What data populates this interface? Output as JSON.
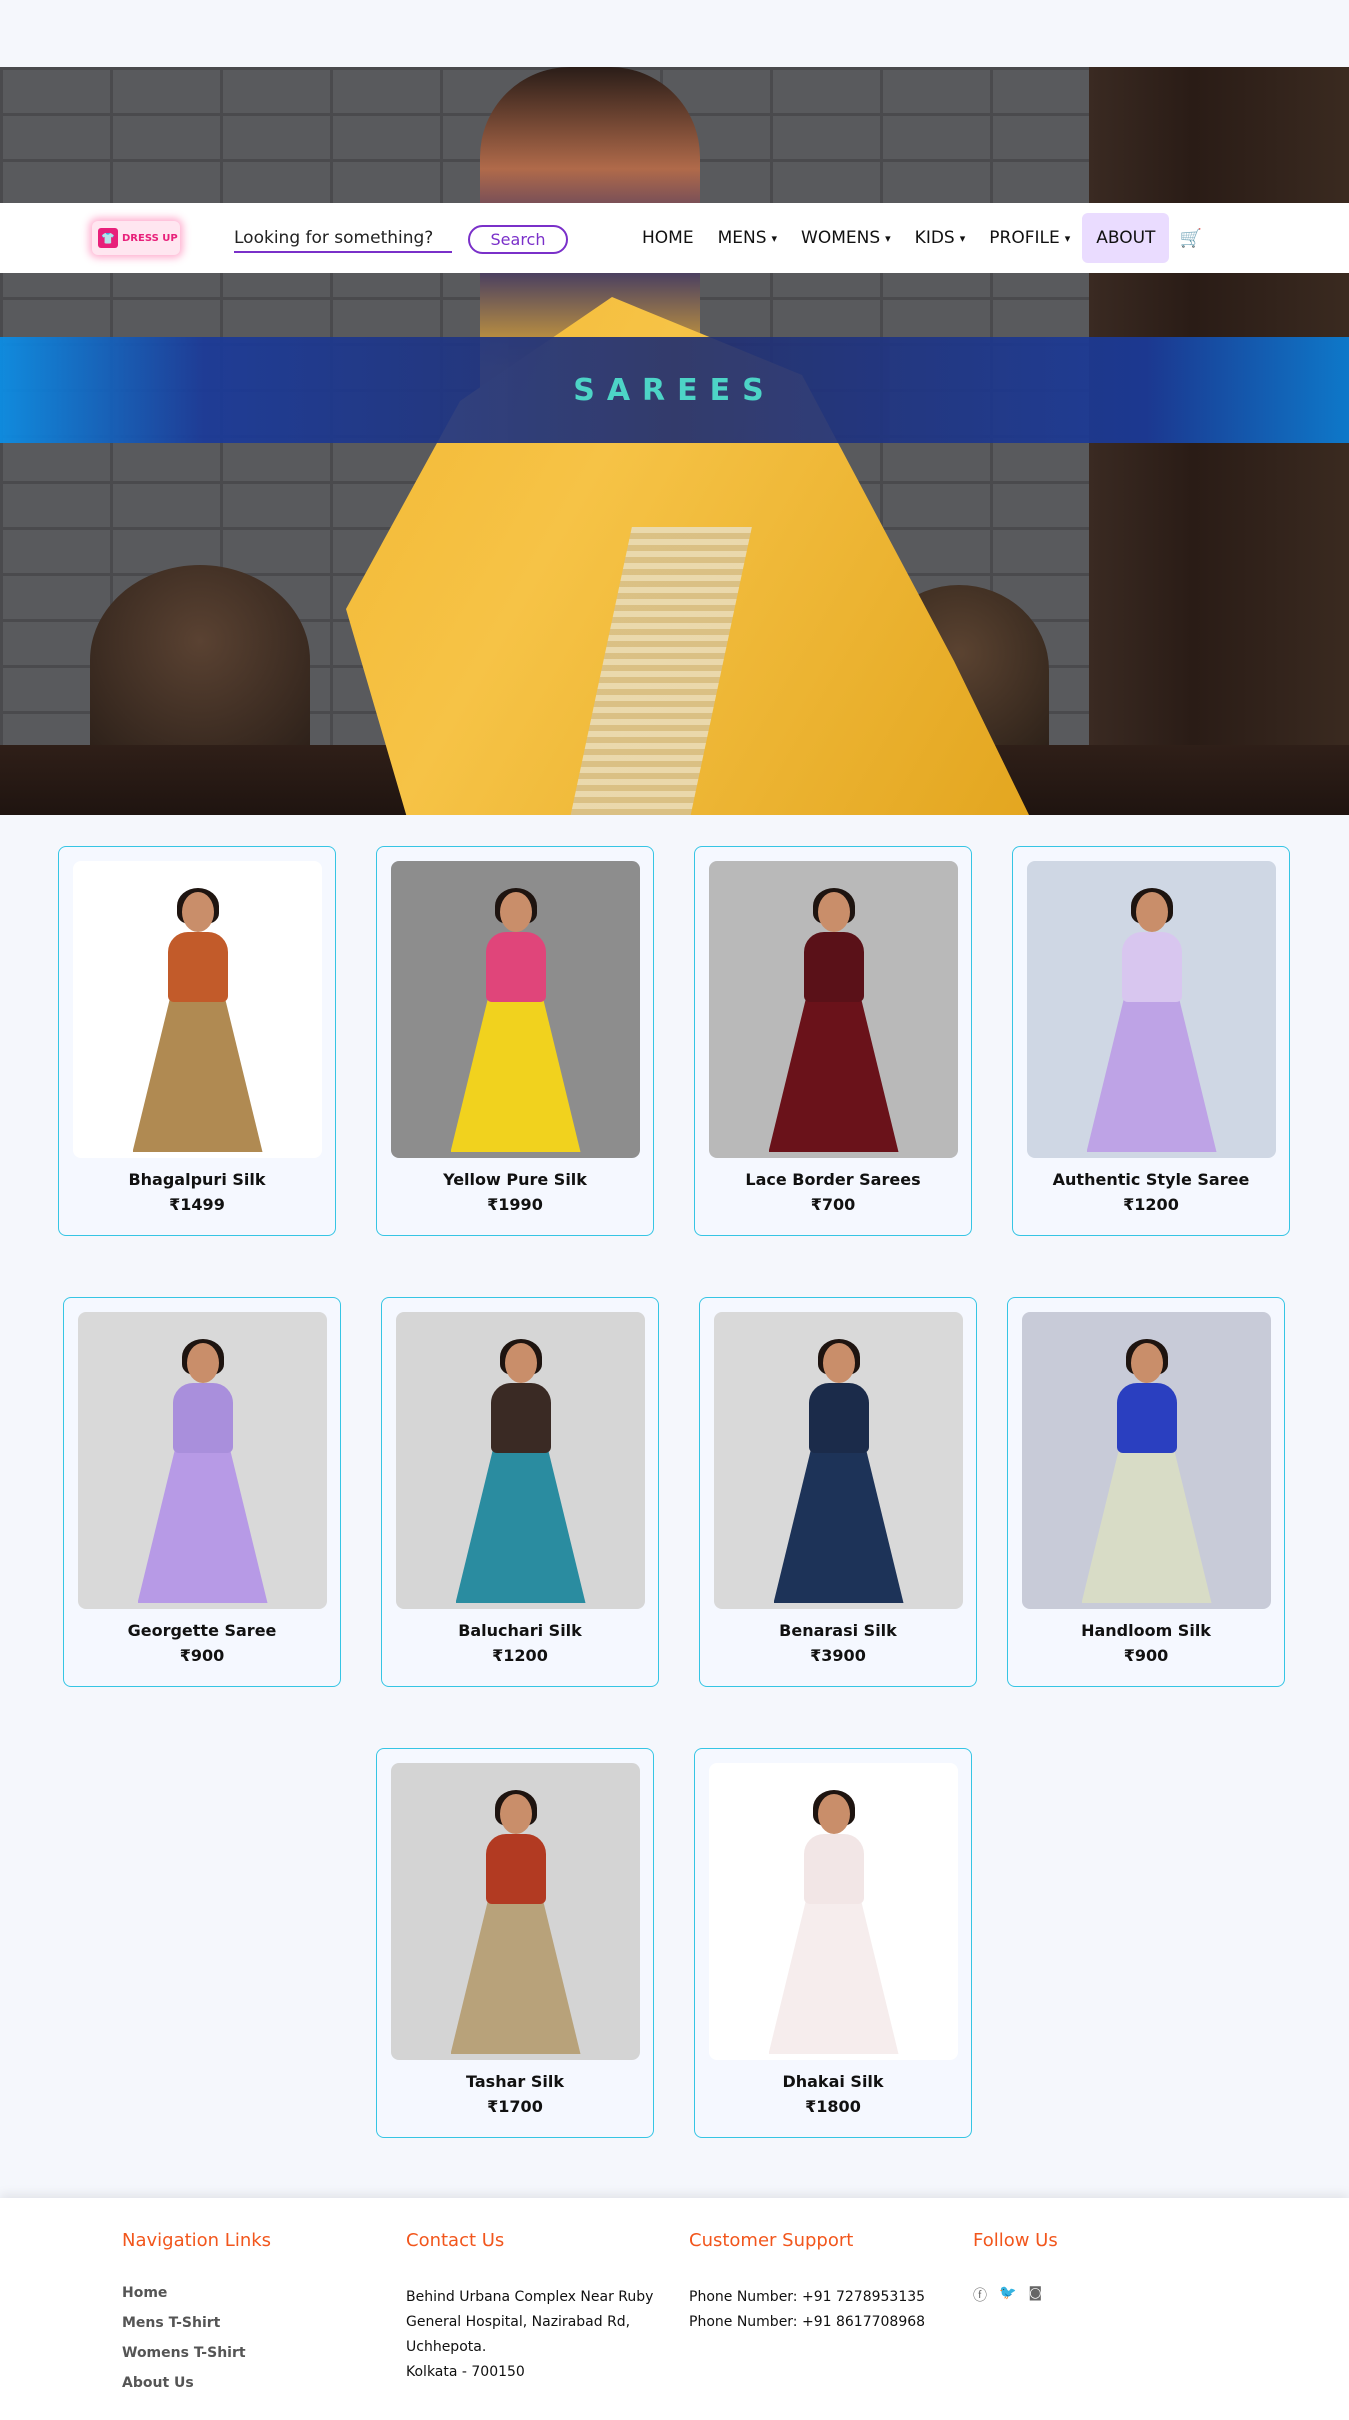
{
  "brand": {
    "logo_text": "DRESS UP"
  },
  "search": {
    "placeholder": "Looking for something?",
    "button_label": "Search"
  },
  "nav": {
    "items": [
      {
        "label": "HOME",
        "has_caret": false
      },
      {
        "label": "MENS",
        "has_caret": true
      },
      {
        "label": "WOMENS",
        "has_caret": true
      },
      {
        "label": "KIDS",
        "has_caret": true
      },
      {
        "label": "PROFILE",
        "has_caret": true
      },
      {
        "label": "ABOUT",
        "has_caret": false,
        "active": true
      }
    ],
    "caret": "▾",
    "cart_icon": "🛒"
  },
  "hero": {
    "banner_title": "SAREES"
  },
  "products": [
    {
      "name": "Bhagalpuri Silk",
      "price": "₹1499",
      "bg": "#ffffff",
      "body": "#c25b2a",
      "drape": "#b08a52"
    },
    {
      "name": "Yellow Pure Silk",
      "price": "₹1990",
      "bg": "#8d8d8d",
      "body": "#e0457a",
      "drape": "#f1d21e"
    },
    {
      "name": "Lace Border Sarees",
      "price": "₹700",
      "bg": "#b9b9b9",
      "body": "#5a1118",
      "drape": "#6a121a"
    },
    {
      "name": "Authentic Style Saree",
      "price": "₹1200",
      "bg": "#cfd7e4",
      "body": "#d8c6ef",
      "drape": "#bea3e6"
    },
    {
      "name": "Georgette Saree",
      "price": "₹900",
      "bg": "#d9d9d9",
      "body": "#a98fdc",
      "drape": "#b79ae6"
    },
    {
      "name": "Baluchari Silk",
      "price": "₹1200",
      "bg": "#d6d6d6",
      "body": "#3a2a24",
      "drape": "#2a8ca0"
    },
    {
      "name": "Benarasi Silk",
      "price": "₹3900",
      "bg": "#d9d9d9",
      "body": "#1b2b4a",
      "drape": "#1d3358"
    },
    {
      "name": "Handloom Silk",
      "price": "₹900",
      "bg": "#c8cbd8",
      "body": "#2a3fc0",
      "drape": "#d8dcc6"
    },
    {
      "name": "Tashar Silk",
      "price": "₹1700",
      "bg": "#d4d4d4",
      "body": "#b23a22",
      "drape": "#b8a27a"
    },
    {
      "name": "Dhakai Silk",
      "price": "₹1800",
      "bg": "#ffffff",
      "body": "#f2e6e6",
      "drape": "#f6eded"
    }
  ],
  "footer": {
    "nav": {
      "heading": "Navigation Links",
      "links": [
        "Home",
        "Mens T-Shirt",
        "Womens T-Shirt",
        "About Us"
      ]
    },
    "contact": {
      "heading": "Contact Us",
      "lines": [
        "Behind Urbana Complex Near Ruby",
        "General Hospital, Nazirabad Rd,",
        "Uchhepota.",
        "Kolkata - 700150"
      ]
    },
    "support": {
      "heading": "Customer Support",
      "lines": [
        "Phone Number: +91 7278953135",
        "Phone Number: +91 8617708968"
      ]
    },
    "follow": {
      "heading": "Follow Us",
      "icons": [
        "facebook-icon",
        "twitter-icon",
        "instagram-icon"
      ],
      "glyphs": [
        "ⓕ",
        "🐦",
        "◙"
      ]
    }
  }
}
